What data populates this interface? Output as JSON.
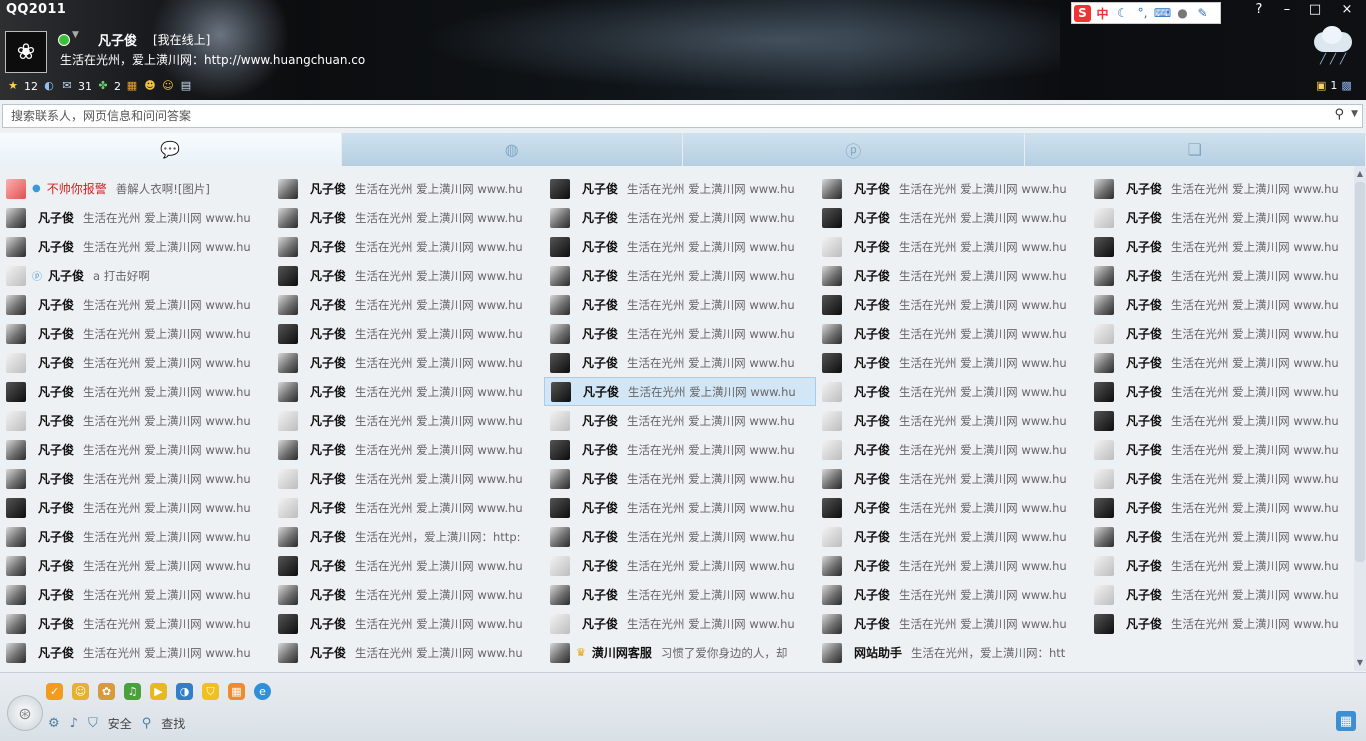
{
  "window": {
    "title": "QQ2011",
    "controls": [
      "?",
      "–",
      "□",
      "×"
    ]
  },
  "profile": {
    "nickname": "凡子俊",
    "status": "[我在线上]",
    "signature": "生活在光州，爱上潢川网：http://www.huangchuan.co",
    "counters": {
      "favorites": "12",
      "mail": "31",
      "clover": "2",
      "right_box": "1"
    }
  },
  "toolbar_icons": [
    "sogou-s-icon",
    "zhong-char",
    "moon-icon",
    "punct-icon",
    "keyboard-icon",
    "user-icon",
    "wrench-icon"
  ],
  "toolbar_text": {
    "sogou": "S",
    "ime": "中"
  },
  "search": {
    "placeholder": "搜索联系人，网页信息和问问答案"
  },
  "tabs": [
    "conversation-tab",
    "chat-tab",
    "qzone-tab",
    "recent-tab"
  ],
  "contacts": [
    [
      {
        "name": "不帅你报警",
        "sig": "善解人衣啊![图片]",
        "red": true,
        "badge": "●",
        "av": "red"
      },
      {
        "name": "凡子俊",
        "sig": "生活在光州 爱上潢川网 www.hu",
        "av": "g"
      },
      {
        "name": "凡子俊",
        "sig": "生活在光州 爱上潢川网 www.hu",
        "av": "g"
      },
      {
        "name": "凡子俊",
        "sig": "a    打击好啊",
        "badge": "ⓟ",
        "av": "light"
      },
      {
        "name": "凡子俊",
        "sig": "生活在光州 爱上潢川网 www.hu",
        "av": "g"
      },
      {
        "name": "凡子俊",
        "sig": "生活在光州 爱上潢川网 www.hu",
        "av": "g"
      },
      {
        "name": "凡子俊",
        "sig": "生活在光州 爱上潢川网 www.hu",
        "av": "light"
      },
      {
        "name": "凡子俊",
        "sig": "生活在光州 爱上潢川网 www.hu",
        "av": "dark"
      },
      {
        "name": "凡子俊",
        "sig": "生活在光州 爱上潢川网 www.hu",
        "av": "light"
      },
      {
        "name": "凡子俊",
        "sig": "生活在光州 爱上潢川网 www.hu",
        "av": "g"
      },
      {
        "name": "凡子俊",
        "sig": "生活在光州 爱上潢川网 www.hu",
        "av": "g"
      },
      {
        "name": "凡子俊",
        "sig": "生活在光州 爱上潢川网 www.hu",
        "av": "dark"
      },
      {
        "name": "凡子俊",
        "sig": "生活在光州 爱上潢川网 www.hu",
        "av": "g"
      },
      {
        "name": "凡子俊",
        "sig": "生活在光州 爱上潢川网 www.hu",
        "av": "g"
      },
      {
        "name": "凡子俊",
        "sig": "生活在光州 爱上潢川网 www.hu",
        "av": "g"
      },
      {
        "name": "凡子俊",
        "sig": "生活在光州 爱上潢川网 www.hu",
        "av": "g"
      },
      {
        "name": "凡子俊",
        "sig": "生活在光州 爱上潢川网 www.hu",
        "av": "g"
      }
    ],
    [
      {
        "name": "凡子俊",
        "sig": "生活在光州 爱上潢川网 www.hu",
        "av": "g"
      },
      {
        "name": "凡子俊",
        "sig": "生活在光州 爱上潢川网 www.hu",
        "av": "g"
      },
      {
        "name": "凡子俊",
        "sig": "生活在光州 爱上潢川网 www.hu",
        "av": "g"
      },
      {
        "name": "凡子俊",
        "sig": "生活在光州 爱上潢川网 www.hu",
        "av": "dark"
      },
      {
        "name": "凡子俊",
        "sig": "生活在光州 爱上潢川网 www.hu",
        "av": "g"
      },
      {
        "name": "凡子俊",
        "sig": "生活在光州 爱上潢川网 www.hu",
        "av": "dark"
      },
      {
        "name": "凡子俊",
        "sig": "生活在光州 爱上潢川网 www.hu",
        "av": "g"
      },
      {
        "name": "凡子俊",
        "sig": "生活在光州 爱上潢川网 www.hu",
        "av": "g"
      },
      {
        "name": "凡子俊",
        "sig": "生活在光州 爱上潢川网 www.hu",
        "av": "light"
      },
      {
        "name": "凡子俊",
        "sig": "生活在光州 爱上潢川网 www.hu",
        "av": "g"
      },
      {
        "name": "凡子俊",
        "sig": "生活在光州 爱上潢川网 www.hu",
        "av": "light"
      },
      {
        "name": "凡子俊",
        "sig": "生活在光州 爱上潢川网 www.hu",
        "av": "light"
      },
      {
        "name": "凡子俊",
        "sig": "生活在光州，爱上潢川网：http:",
        "av": "g"
      },
      {
        "name": "凡子俊",
        "sig": "生活在光州 爱上潢川网 www.hu",
        "av": "dark"
      },
      {
        "name": "凡子俊",
        "sig": "生活在光州 爱上潢川网 www.hu",
        "av": "g"
      },
      {
        "name": "凡子俊",
        "sig": "生活在光州 爱上潢川网 www.hu",
        "av": "dark"
      },
      {
        "name": "凡子俊",
        "sig": "生活在光州 爱上潢川网 www.hu",
        "av": "g"
      }
    ],
    [
      {
        "name": "凡子俊",
        "sig": "生活在光州 爱上潢川网 www.hu",
        "av": "dark"
      },
      {
        "name": "凡子俊",
        "sig": "生活在光州 爱上潢川网 www.hu",
        "av": "g"
      },
      {
        "name": "凡子俊",
        "sig": "生活在光州 爱上潢川网 www.hu",
        "av": "dark"
      },
      {
        "name": "凡子俊",
        "sig": "生活在光州 爱上潢川网 www.hu",
        "av": "g"
      },
      {
        "name": "凡子俊",
        "sig": "生活在光州 爱上潢川网 www.hu",
        "av": "g"
      },
      {
        "name": "凡子俊",
        "sig": "生活在光州 爱上潢川网 www.hu",
        "av": "g"
      },
      {
        "name": "凡子俊",
        "sig": "生活在光州 爱上潢川网 www.hu",
        "av": "dark"
      },
      {
        "name": "凡子俊",
        "sig": "生活在光州 爱上潢川网 www.hu",
        "av": "dark",
        "sel": true
      },
      {
        "name": "凡子俊",
        "sig": "生活在光州 爱上潢川网 www.hu",
        "av": "light"
      },
      {
        "name": "凡子俊",
        "sig": "生活在光州 爱上潢川网 www.hu",
        "av": "dark"
      },
      {
        "name": "凡子俊",
        "sig": "生活在光州 爱上潢川网 www.hu",
        "av": "g"
      },
      {
        "name": "凡子俊",
        "sig": "生活在光州 爱上潢川网 www.hu",
        "av": "dark"
      },
      {
        "name": "凡子俊",
        "sig": "生活在光州 爱上潢川网 www.hu",
        "av": "g"
      },
      {
        "name": "凡子俊",
        "sig": "生活在光州 爱上潢川网 www.hu",
        "av": "light"
      },
      {
        "name": "凡子俊",
        "sig": "生活在光州 爱上潢川网 www.hu",
        "av": "g"
      },
      {
        "name": "凡子俊",
        "sig": "生活在光州 爱上潢川网 www.hu",
        "av": "light"
      },
      {
        "name": "潢川网客服",
        "sig": "习惯了爱你身边的人，却",
        "crown": "♛",
        "av": "g"
      }
    ],
    [
      {
        "name": "凡子俊",
        "sig": "生活在光州 爱上潢川网 www.hu",
        "av": "g"
      },
      {
        "name": "凡子俊",
        "sig": "生活在光州 爱上潢川网 www.hu",
        "av": "dark"
      },
      {
        "name": "凡子俊",
        "sig": "生活在光州 爱上潢川网 www.hu",
        "av": "light"
      },
      {
        "name": "凡子俊",
        "sig": "生活在光州 爱上潢川网 www.hu",
        "av": "g"
      },
      {
        "name": "凡子俊",
        "sig": "生活在光州 爱上潢川网 www.hu",
        "av": "dark"
      },
      {
        "name": "凡子俊",
        "sig": "生活在光州 爱上潢川网 www.hu",
        "av": "g"
      },
      {
        "name": "凡子俊",
        "sig": "生活在光州 爱上潢川网 www.hu",
        "av": "dark"
      },
      {
        "name": "凡子俊",
        "sig": "生活在光州 爱上潢川网 www.hu",
        "av": "light"
      },
      {
        "name": "凡子俊",
        "sig": "生活在光州 爱上潢川网 www.hu",
        "av": "light"
      },
      {
        "name": "凡子俊",
        "sig": "生活在光州 爱上潢川网 www.hu",
        "av": "light"
      },
      {
        "name": "凡子俊",
        "sig": "生活在光州 爱上潢川网 www.hu",
        "av": "g"
      },
      {
        "name": "凡子俊",
        "sig": "生活在光州 爱上潢川网 www.hu",
        "av": "dark"
      },
      {
        "name": "凡子俊",
        "sig": "生活在光州 爱上潢川网 www.hu",
        "av": "light"
      },
      {
        "name": "凡子俊",
        "sig": "生活在光州 爱上潢川网 www.hu",
        "av": "g"
      },
      {
        "name": "凡子俊",
        "sig": "生活在光州 爱上潢川网 www.hu",
        "av": "g"
      },
      {
        "name": "凡子俊",
        "sig": "生活在光州 爱上潢川网 www.hu",
        "av": "g"
      },
      {
        "name": "网站助手",
        "sig": "生活在光州，爱上潢川网：htt",
        "av": "g"
      }
    ],
    [
      {
        "name": "凡子俊",
        "sig": "生活在光州 爱上潢川网 www.hu",
        "av": "g"
      },
      {
        "name": "凡子俊",
        "sig": "生活在光州 爱上潢川网 www.hu",
        "av": "light"
      },
      {
        "name": "凡子俊",
        "sig": "生活在光州 爱上潢川网 www.hu",
        "av": "dark"
      },
      {
        "name": "凡子俊",
        "sig": "生活在光州 爱上潢川网 www.hu",
        "av": "g"
      },
      {
        "name": "凡子俊",
        "sig": "生活在光州 爱上潢川网 www.hu",
        "av": "g"
      },
      {
        "name": "凡子俊",
        "sig": "生活在光州 爱上潢川网 www.hu",
        "av": "light"
      },
      {
        "name": "凡子俊",
        "sig": "生活在光州 爱上潢川网 www.hu",
        "av": "g"
      },
      {
        "name": "凡子俊",
        "sig": "生活在光州 爱上潢川网 www.hu",
        "av": "dark"
      },
      {
        "name": "凡子俊",
        "sig": "生活在光州 爱上潢川网 www.hu",
        "av": "dark"
      },
      {
        "name": "凡子俊",
        "sig": "生活在光州 爱上潢川网 www.hu",
        "av": "light"
      },
      {
        "name": "凡子俊",
        "sig": "生活在光州 爱上潢川网 www.hu",
        "av": "light"
      },
      {
        "name": "凡子俊",
        "sig": "生活在光州 爱上潢川网 www.hu",
        "av": "dark"
      },
      {
        "name": "凡子俊",
        "sig": "生活在光州 爱上潢川网 www.hu",
        "av": "g"
      },
      {
        "name": "凡子俊",
        "sig": "生活在光州 爱上潢川网 www.hu",
        "av": "light"
      },
      {
        "name": "凡子俊",
        "sig": "生活在光州 爱上潢川网 www.hu",
        "av": "light"
      },
      {
        "name": "凡子俊",
        "sig": "生活在光州 爱上潢川网 www.hu",
        "av": "dark"
      }
    ]
  ],
  "bottom": {
    "security_label": "安全",
    "find_label": "查找"
  },
  "colors": {
    "accent": "#3a8fd0",
    "alert_name": "#d62020",
    "selected_row": "#d3e6f6"
  }
}
